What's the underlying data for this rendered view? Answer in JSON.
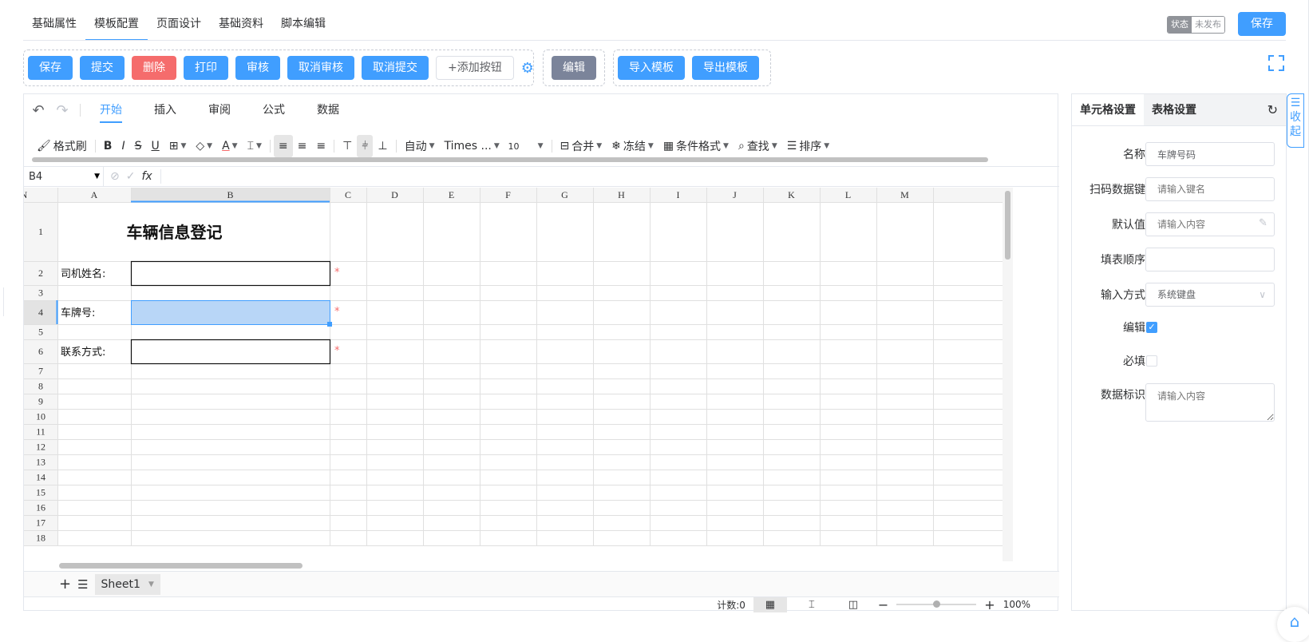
{
  "tabs": [
    "基础属性",
    "模板配置",
    "页面设计",
    "基础资料",
    "脚本编辑"
  ],
  "active_tab": 1,
  "status": {
    "label": "状态",
    "value": "未发布"
  },
  "save_top": "保存",
  "actions": {
    "group1": [
      {
        "label": "保存",
        "style": "primary"
      },
      {
        "label": "提交",
        "style": "primary"
      },
      {
        "label": "删除",
        "style": "danger"
      },
      {
        "label": "打印",
        "style": "primary"
      },
      {
        "label": "审核",
        "style": "primary"
      },
      {
        "label": "取消审核",
        "style": "primary"
      },
      {
        "label": "取消提交",
        "style": "primary"
      },
      {
        "label": "+添加按钮",
        "style": "plain"
      }
    ],
    "group2": [
      {
        "label": "编辑",
        "style": "gray"
      }
    ],
    "group3": [
      {
        "label": "导入模板",
        "style": "primary"
      },
      {
        "label": "导出模板",
        "style": "primary"
      }
    ]
  },
  "menu": [
    "开始",
    "插入",
    "审阅",
    "公式",
    "数据"
  ],
  "active_menu": 0,
  "toolbar": {
    "format_painter": "格式刷",
    "bold": "B",
    "italic": "I",
    "strike": "S",
    "underline": "U",
    "auto": "自动",
    "font": "Times ...",
    "size": "10",
    "merge": "合并",
    "freeze": "冻结",
    "cond_format": "条件格式",
    "find": "查找",
    "sort": "排序"
  },
  "formula_bar": {
    "cell_ref": "B4",
    "fx": "fx"
  },
  "columns": [
    "A",
    "B",
    "C",
    "D",
    "E",
    "F",
    "G",
    "H",
    "I",
    "J",
    "K",
    "L",
    "M",
    "N"
  ],
  "rows": [
    "1",
    "2",
    "3",
    "4",
    "5",
    "6",
    "7",
    "8",
    "9",
    "10",
    "11",
    "12",
    "13",
    "14",
    "15",
    "16",
    "17",
    "18"
  ],
  "cells": {
    "title": "车辆信息登记",
    "a2": "司机姓名:",
    "a4": "车牌号:",
    "a6": "联系方式:",
    "required_mark": "*"
  },
  "sheet_tab": "Sheet1",
  "statusbar": {
    "count": "计数:0",
    "zoom": "100%"
  },
  "panel": {
    "tabs": [
      "单元格设置",
      "表格设置"
    ],
    "fields": {
      "name_label": "名称",
      "name_value": "车牌号码",
      "scan_label": "扫码数据键",
      "scan_placeholder": "请输入键名",
      "default_label": "默认值",
      "default_placeholder": "请输入内容",
      "order_label": "填表顺序",
      "order_value": "",
      "input_label": "输入方式",
      "input_value": "系统键盘",
      "edit_label": "编辑",
      "edit_checked": true,
      "required_label": "必填",
      "required_checked": false,
      "tag_label": "数据标识",
      "tag_placeholder": "请输入内容"
    }
  },
  "collapse_label": "收起",
  "colors": {
    "primary": "#409eff",
    "danger": "#f56c6c",
    "gray": "#7b849a",
    "selection": "#b8d6f7"
  }
}
